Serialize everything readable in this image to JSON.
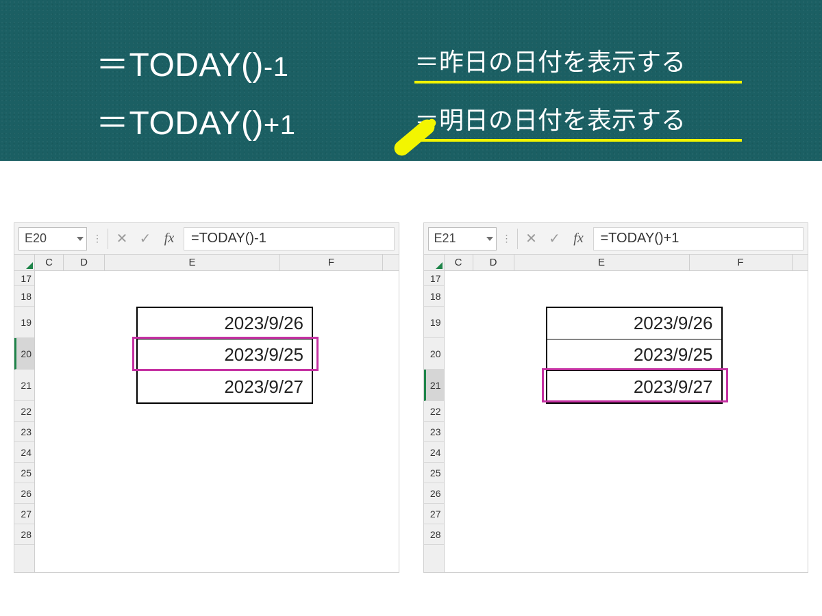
{
  "header": {
    "formula1_eq": "＝",
    "formula1_fn": "TODAY()",
    "formula1_suffix": "-1",
    "formula2_eq": "＝",
    "formula2_fn": "TODAY()",
    "formula2_suffix": "+1",
    "desc1": "＝昨日の日付を表示する",
    "desc2": "＝明日の日付を表示する"
  },
  "pane_left": {
    "namebox": "E20",
    "formula": "=TODAY()-1",
    "cols": [
      "C",
      "D",
      "E",
      "F"
    ],
    "row_numbers": [
      "17",
      "18",
      "19",
      "20",
      "21",
      "22",
      "23",
      "24",
      "25",
      "26",
      "27",
      "28"
    ],
    "selected_row": "20",
    "data": {
      "r19": "2023/9/26",
      "r20": "2023/9/25",
      "r21": "2023/9/27"
    },
    "highlight_row": "20"
  },
  "pane_right": {
    "namebox": "E21",
    "formula": "=TODAY()+1",
    "cols": [
      "C",
      "D",
      "E",
      "F"
    ],
    "row_numbers": [
      "17",
      "18",
      "19",
      "20",
      "21",
      "22",
      "23",
      "24",
      "25",
      "26",
      "27",
      "28"
    ],
    "selected_row": "21",
    "data": {
      "r19": "2023/9/26",
      "r20": "2023/9/25",
      "r21": "2023/9/27"
    },
    "highlight_row": "21"
  }
}
